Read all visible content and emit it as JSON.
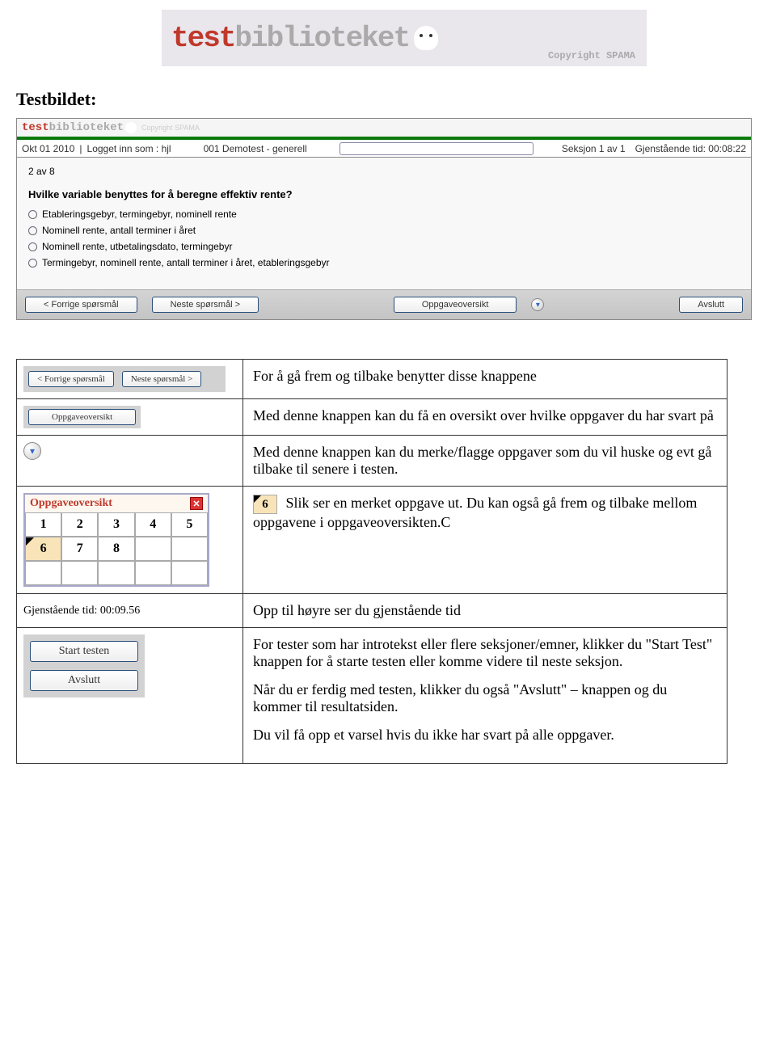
{
  "brand": {
    "red": "test",
    "grey": "biblioteket",
    "copyright": "Copyright SPAMA"
  },
  "section_title": "Testbildet:",
  "app": {
    "subbar_date": "Okt 01 2010",
    "subbar_login": "Logget inn som : hjl",
    "demotest": "001 Demotest - generell",
    "section": "Seksjon 1 av 1",
    "time_label": "Gjenstående tid: 00:08:22",
    "counter": "2 av 8",
    "question": "Hvilke variable benyttes for å beregne effektiv rente?",
    "options": [
      "Etableringsgebyr, termingebyr, nominell rente",
      "Nominell rente, antall terminer i året",
      "Nominell rente, utbetalingsdato, termingebyr",
      "Termingebyr, nominell rente, antall terminer i året, etableringsgebyr"
    ],
    "footer": {
      "prev": "< Forrige spørsmål",
      "next": "Neste spørsmål >",
      "overview": "Oppgaveoversikt",
      "finish": "Avslutt"
    }
  },
  "rows": {
    "r1": {
      "btn_prev": "< Forrige spørsmål",
      "btn_next": "Neste spørsmål >",
      "text": "For å gå frem og tilbake benytter disse knappene"
    },
    "r2": {
      "btn": "Oppgaveoversikt",
      "text": "Med denne knappen kan du få en oversikt over hvilke oppgaver du har svart på"
    },
    "r3": {
      "text": "Med denne knappen kan du merke/flagge oppgaver som du vil huske og evt gå tilbake til senere i testen."
    },
    "r4": {
      "panel_title": "Oppgaveoversikt",
      "flag_num": "6",
      "nums": [
        "1",
        "2",
        "3",
        "4",
        "5",
        "6",
        "7",
        "8"
      ],
      "text_a": "Slik ser en merket oppgave ut. Du kan også gå frem og tilbake mellom oppgavene i oppgaveoversikten.C"
    },
    "r5": {
      "time": "Gjenstående tid: 00:09.56",
      "text": "Opp til høyre ser du gjenstående tid"
    },
    "r6": {
      "btn_start": "Start testen",
      "btn_end": "Avslutt",
      "p1": "For tester som har introtekst eller flere seksjoner/emner, klikker du \"Start Test\" knappen for å starte testen eller komme videre til neste seksjon.",
      "p2": "Når du er ferdig med testen, klikker du også \"Avslutt\" – knappen og du kommer til resultatsiden.",
      "p3": "Du vil få opp et varsel hvis du ikke har svart på alle oppgaver."
    }
  }
}
